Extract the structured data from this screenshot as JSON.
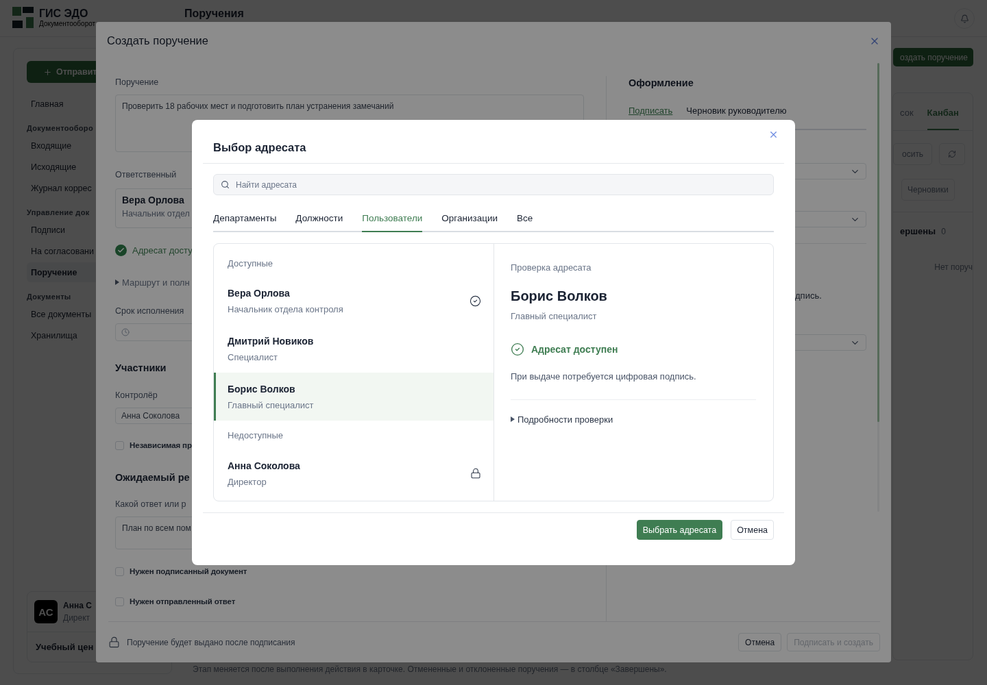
{
  "app": {
    "logo": {
      "title": "ГИС ЭДО",
      "subtitle": "Документооборот"
    },
    "page_title": "Поручения",
    "sidebar": {
      "primary_button": "Отправит",
      "items": [
        {
          "kind": "link",
          "label": "Главная",
          "selected": false
        },
        {
          "kind": "section",
          "label": "Документооборо"
        },
        {
          "kind": "link",
          "label": "Входящие",
          "selected": false
        },
        {
          "kind": "link",
          "label": "Исходящие",
          "selected": false
        },
        {
          "kind": "link",
          "label": "Журнал коррес",
          "selected": false
        },
        {
          "kind": "section",
          "label": "Управление док"
        },
        {
          "kind": "link",
          "label": "Подписи",
          "selected": false
        },
        {
          "kind": "link",
          "label": "На согласовани",
          "selected": false
        },
        {
          "kind": "link",
          "label": "Поручение",
          "selected": true
        },
        {
          "kind": "section",
          "label": "Документы"
        },
        {
          "kind": "link",
          "label": "Все документы",
          "selected": false
        },
        {
          "kind": "link",
          "label": "Хранилища",
          "selected": false
        }
      ],
      "user": {
        "initials": "АС",
        "name": "Анна С",
        "role": "Директ"
      },
      "org": "Учебный цен"
    },
    "board": {
      "create_button": "оздать поручение",
      "tabs": [
        {
          "label": "сок",
          "selected": false
        },
        {
          "label": "Канбан",
          "selected": true
        }
      ],
      "reset_button": "осить",
      "filter_button": "Черновики",
      "column": {
        "title": "ершены",
        "count": "0",
        "empty": "Нет поруч"
      },
      "note": "Этап меняется после выполнения действия в карточке. Отмененные и отклоненные поручения — в столбце «Завершены»."
    }
  },
  "create_dialog": {
    "title": "Создать поручение",
    "task": {
      "label": "Поручение",
      "value": "Проверить 18 рабочих мест и подготовить план устранения замечаний"
    },
    "responsible": {
      "label": "Ответственный",
      "name": "Вера Орлова",
      "role": "Начальник отдел"
    },
    "availability": "Адресат досту",
    "route": "Маршрут и полн",
    "deadline": {
      "label": "Срок исполнения"
    },
    "participants": {
      "title": "Участники",
      "controller_label": "Контролёр",
      "controller_value": "Анна Соколова",
      "independent": {
        "label": "Независимая пр",
        "checked": false
      }
    },
    "result": {
      "title": "Ожидаемый ре",
      "question": "Какой ответ или р",
      "answer": "План по всем пом",
      "options": [
        {
          "label": "Нужен подписанный документ",
          "checked": false
        },
        {
          "label": "Нужен отправленный ответ",
          "checked": false
        }
      ]
    },
    "design": {
      "title": "Оформление",
      "tabs": [
        {
          "label": "Подписать",
          "selected": true
        },
        {
          "label": "Черновик руководителю",
          "selected": false
        }
      ],
      "note": "дпись."
    },
    "footer": {
      "hint": "Поручение будет выдано после подписания",
      "buttons": [
        {
          "label": "Отмена",
          "disabled": false
        },
        {
          "label": "Подписать и создать",
          "disabled": true
        }
      ]
    }
  },
  "recipient_dialog": {
    "title": "Выбор адресата",
    "search": {
      "placeholder": "Найти адресата"
    },
    "tabs": [
      {
        "label": "Департаменты",
        "selected": false
      },
      {
        "label": "Должности",
        "selected": false
      },
      {
        "label": "Пользователи",
        "selected": true
      },
      {
        "label": "Организации",
        "selected": false
      },
      {
        "label": "Все",
        "selected": false
      }
    ],
    "groups": [
      {
        "label": "Доступные",
        "items": [
          {
            "name": "Вера Орлова",
            "role": "Начальник отдела контроля",
            "kind": "current",
            "selected": false
          },
          {
            "name": "Дмитрий Новиков",
            "role": "Специалист",
            "kind": "plain",
            "selected": false
          },
          {
            "name": "Борис Волков",
            "role": "Главный специалист",
            "kind": "plain",
            "selected": true
          }
        ]
      },
      {
        "label": "Недоступные",
        "items": [
          {
            "name": "Анна Соколова",
            "role": "Директор",
            "kind": "locked",
            "selected": false
          }
        ]
      }
    ],
    "detail": {
      "caption": "Проверка адресата",
      "name": "Борис Волков",
      "role": "Главный специалист",
      "available": true,
      "status": "Адресат доступен",
      "note": "При выдаче потребуется цифровая подпись.",
      "details": "Подробности проверки"
    },
    "buttons": [
      {
        "label": "Выбрать адресата",
        "kind": "primary"
      },
      {
        "label": "Отмена",
        "kind": "secondary"
      }
    ]
  }
}
